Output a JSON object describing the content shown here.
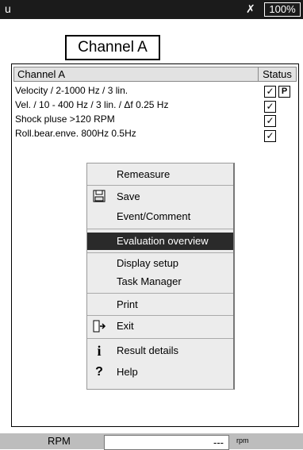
{
  "topbar": {
    "app_label": "u",
    "battery_icon": "battery-warning-icon",
    "battery_text": "100%"
  },
  "channel_title": "Channel A",
  "table": {
    "col_channel": "Channel A",
    "col_status": "Status",
    "rows": [
      {
        "label": "Velocity / 2-1000 Hz / 3 lin.",
        "status": "✓",
        "badge": "P"
      },
      {
        "label": "Vel. / 10 - 400 Hz / 3 lin.  / Δf 0.25 Hz",
        "status": "✓"
      },
      {
        "label": "Shock pluse >120 RPM",
        "status": "✓"
      },
      {
        "label": "Roll.bear.enve. 800Hz  0.5Hz",
        "status": "✓"
      }
    ]
  },
  "menu": {
    "items": [
      {
        "label": "Remeasure",
        "icon": ""
      },
      {
        "label": "Save",
        "icon": "floppy-disk-icon"
      },
      {
        "label": "Event/Comment",
        "icon": ""
      },
      {
        "label": "Evaluation overview",
        "icon": "",
        "selected": true
      },
      {
        "label": "Display setup",
        "icon": ""
      },
      {
        "label": "Task Manager",
        "icon": ""
      },
      {
        "label": "Print",
        "icon": ""
      },
      {
        "label": "Exit",
        "icon": "exit-door-icon"
      },
      {
        "label": "Result details",
        "icon": "info-icon"
      },
      {
        "label": "Help",
        "icon": "help-icon"
      }
    ]
  },
  "bottom": {
    "label": "RPM",
    "value": "---",
    "unit": "rpm"
  }
}
